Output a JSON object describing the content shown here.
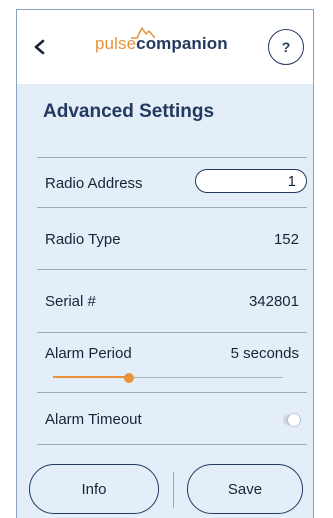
{
  "header": {
    "logo_part1": "pulse",
    "logo_part2": "companion",
    "help_label": "?",
    "back_icon": "chevron-left-icon"
  },
  "page": {
    "title": "Advanced Settings"
  },
  "settings": {
    "radio_address": {
      "label": "Radio Address",
      "value": "1"
    },
    "radio_type": {
      "label": "Radio Type",
      "value": "152"
    },
    "serial": {
      "label": "Serial #",
      "value": "342801"
    },
    "alarm_period": {
      "label": "Alarm Period",
      "value": "5 seconds",
      "slider_fraction": 0.33
    },
    "alarm_timeout": {
      "label": "Alarm Timeout",
      "enabled": false
    }
  },
  "actions": {
    "info_label": "Info",
    "save_label": "Save"
  },
  "colors": {
    "brand_navy": "#23395f",
    "accent_orange": "#e8923a",
    "background": "#e3eef8"
  }
}
